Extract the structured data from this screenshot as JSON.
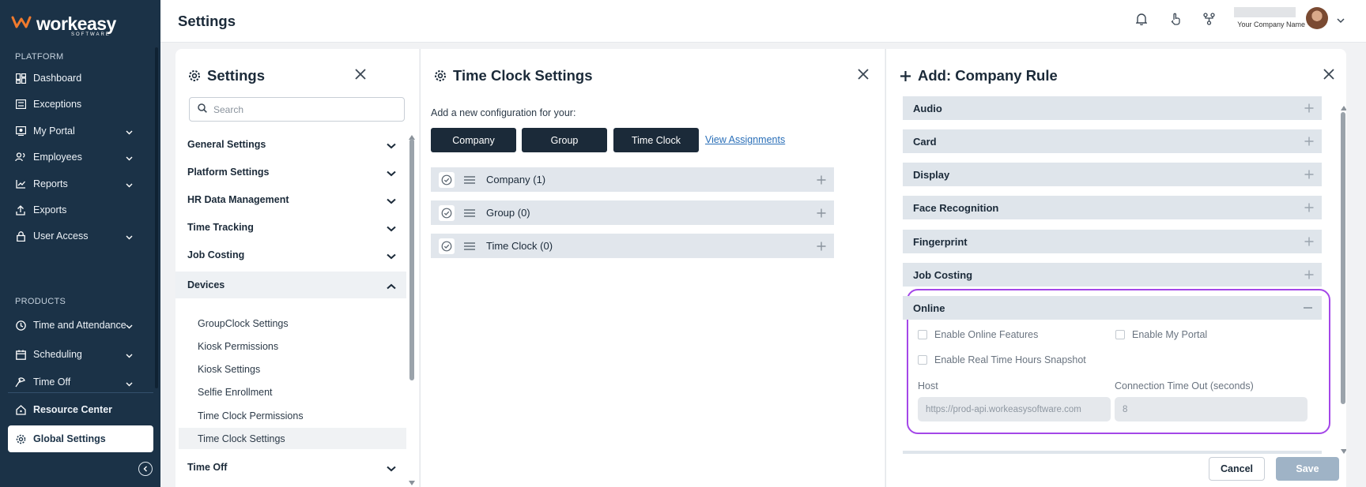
{
  "nav": {
    "brand": "workeasy",
    "brand_sub": "SOFTWARE",
    "section_platform": "PLATFORM",
    "section_products": "PRODUCTS",
    "items": [
      {
        "label": "Dashboard",
        "icon": "dashboard-icon"
      },
      {
        "label": "Exceptions",
        "icon": "list-icon"
      },
      {
        "label": "My Portal",
        "icon": "portal-icon"
      },
      {
        "label": "Employees",
        "icon": "people-icon"
      },
      {
        "label": "Reports",
        "icon": "chart-icon"
      },
      {
        "label": "Exports",
        "icon": "upload-icon"
      },
      {
        "label": "User Access",
        "icon": "lock-icon"
      },
      {
        "label": "Time and Attendance",
        "icon": "clock-icon"
      },
      {
        "label": "Scheduling",
        "icon": "calendar-icon"
      },
      {
        "label": "Time Off",
        "icon": "time-off-icon"
      },
      {
        "label": "Resource Center",
        "icon": "home-icon"
      },
      {
        "label": "Global Settings",
        "icon": "gear-icon"
      }
    ]
  },
  "header": {
    "title": "Settings",
    "company_name": "Your Company Name"
  },
  "settings_panel": {
    "title": "Settings",
    "search_placeholder": "Search",
    "categories": [
      "General Settings",
      "Platform Settings",
      "HR Data Management",
      "Time Tracking",
      "Job Costing",
      "Devices",
      "Time Off"
    ],
    "device_items": [
      "GroupClock Settings",
      "Kiosk Permissions",
      "Kiosk Settings",
      "Selfie Enrollment",
      "Time Clock Permissions",
      "Time Clock Settings"
    ]
  },
  "timeclock_panel": {
    "title": "Time Clock Settings",
    "prompt": "Add a new configuration for your:",
    "buttons": [
      "Company",
      "Group",
      "Time Clock"
    ],
    "view_assignments": "View Assignments",
    "rows": [
      "Company (1)",
      "Group (0)",
      "Time Clock (0)"
    ]
  },
  "rule_panel": {
    "title": "Add: Company Rule",
    "sections": [
      "Audio",
      "Card",
      "Display",
      "Face Recognition",
      "Fingerprint",
      "Job Costing"
    ],
    "online": {
      "title": "Online",
      "enable_online_features": "Enable Online Features",
      "enable_my_portal": "Enable My Portal",
      "enable_realtime": "Enable Real Time Hours Snapshot",
      "host_label": "Host",
      "host_value": "https://prod-api.workeasysoftware.com",
      "timeout_label": "Connection Time Out (seconds)",
      "timeout_value": "8"
    },
    "cancel": "Cancel",
    "save": "Save"
  },
  "colors": {
    "nav_bg": "#1b3247",
    "dark_button": "#1b2a39",
    "highlight": "#a447e8",
    "link": "#2a6fb8",
    "save_disabled": "#9fb3c6"
  }
}
